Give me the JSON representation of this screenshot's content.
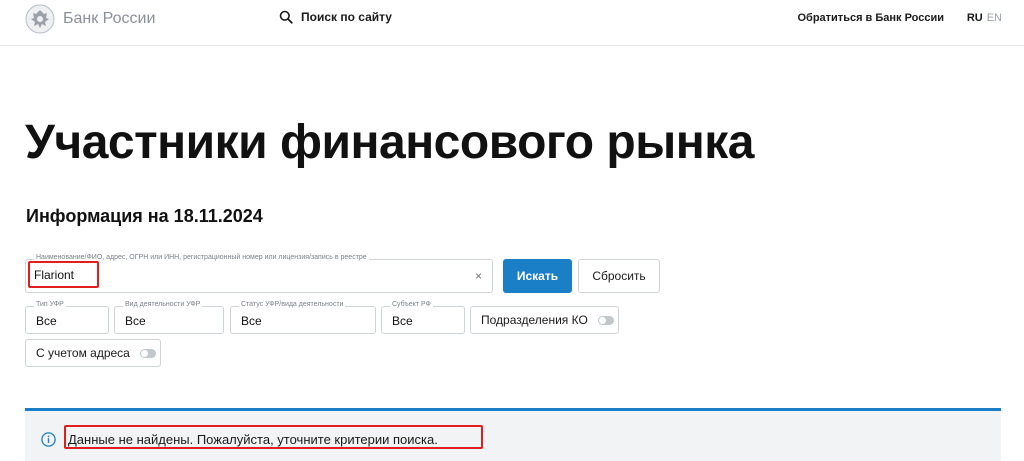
{
  "header": {
    "logo_text": "Банк России",
    "search_label": "Поиск по сайту",
    "contact_label": "Обратиться в Банк России",
    "lang_ru": "RU",
    "lang_en": "EN"
  },
  "main": {
    "title": "Участники финансового рынка",
    "info_date": "Информация на 18.11.2024"
  },
  "search": {
    "legend": "Наименование/ФИО, адрес, ОГРН или ИНН, регистрационный номер или лицензия/запись в реестре",
    "value": "Flariont",
    "clear_label": "×",
    "search_button": "Искать",
    "reset_button": "Сбросить"
  },
  "filters": {
    "type": {
      "legend": "Тип УФР",
      "value": "Все"
    },
    "activity": {
      "legend": "Вид деятельности УФР",
      "value": "Все"
    },
    "status": {
      "legend": "Статус УФР/вида деятельности",
      "value": "Все"
    },
    "region": {
      "legend": "Субъект РФ",
      "value": "Все"
    },
    "branches_label": "Подразделения КО",
    "address_label": "С учетом адреса"
  },
  "notice": {
    "text": "Данные не найдены. Пожалуйста, уточните критерии поиска."
  },
  "colors": {
    "accent": "#1a7fc6",
    "highlight": "#e11d1d",
    "notice_bg": "#f1f3f5"
  }
}
